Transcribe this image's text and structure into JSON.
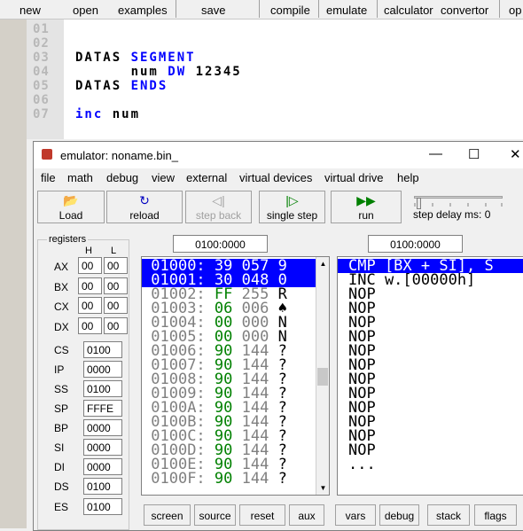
{
  "top_toolbar": {
    "items": [
      "new",
      "open",
      "examples",
      "save",
      "compile",
      "emulate",
      "calculator",
      "convertor",
      "op"
    ]
  },
  "editor": {
    "line_numbers": [
      "01",
      "02",
      "03",
      "04",
      "05",
      "06",
      "07"
    ],
    "lines": [
      {
        "kw": "",
        "text": ""
      },
      {
        "kw": "",
        "text": ""
      },
      {
        "pre": "DATAS ",
        "kw": "SEGMENT",
        "post": ""
      },
      {
        "pre": "      num ",
        "kw": "DW",
        "post": " 12345"
      },
      {
        "pre": "DATAS ",
        "kw": "ENDS",
        "post": ""
      },
      {
        "pre": "",
        "kw": "",
        "post": ""
      },
      {
        "pre": "",
        "kw": "inc",
        "post": " num"
      }
    ]
  },
  "emulator": {
    "title": "emulator: noname.bin_",
    "window_controls": {
      "minimize": "—",
      "maximize": "☐",
      "close": "✕"
    },
    "menu": [
      "file",
      "math",
      "debug",
      "view",
      "external",
      "virtual devices",
      "virtual drive",
      "help"
    ],
    "toolbar": [
      {
        "label": "Load",
        "icon": "📂",
        "icon_name": "folder-open-icon",
        "enabled": true
      },
      {
        "label": "reload",
        "icon": "↻",
        "icon_name": "reload-icon",
        "enabled": true
      },
      {
        "label": "step back",
        "icon": "◁|",
        "icon_name": "step-back-icon",
        "enabled": false
      },
      {
        "label": "single step",
        "icon": "|▷",
        "icon_name": "single-step-icon",
        "enabled": true
      },
      {
        "label": "run",
        "icon": "▶▶",
        "icon_name": "run-icon",
        "enabled": true
      }
    ],
    "step_delay_label": "step delay ms: 0",
    "step_delay_ms": 0,
    "registers": {
      "title": "registers",
      "col_h": "H",
      "col_l": "L",
      "general": [
        {
          "name": "AX",
          "h": "00",
          "l": "00"
        },
        {
          "name": "BX",
          "h": "00",
          "l": "00"
        },
        {
          "name": "CX",
          "h": "00",
          "l": "00"
        },
        {
          "name": "DX",
          "h": "00",
          "l": "00"
        }
      ],
      "segment": [
        {
          "name": "CS",
          "value": "0100"
        },
        {
          "name": "IP",
          "value": "0000"
        },
        {
          "name": "SS",
          "value": "0100"
        },
        {
          "name": "SP",
          "value": "FFFE"
        },
        {
          "name": "BP",
          "value": "0000"
        },
        {
          "name": "SI",
          "value": "0000"
        },
        {
          "name": "DI",
          "value": "0000"
        },
        {
          "name": "DS",
          "value": "0100"
        },
        {
          "name": "ES",
          "value": "0100"
        }
      ]
    },
    "memory_address": "0100:0000",
    "disasm_address": "0100:0000",
    "memory": [
      {
        "addr": "01000:",
        "hex": "39",
        "dec": "057",
        "ch": "9",
        "selected": true
      },
      {
        "addr": "01001:",
        "hex": "30",
        "dec": "048",
        "ch": "0",
        "selected": true
      },
      {
        "addr": "01002:",
        "hex": "FF",
        "dec": "255",
        "ch": "R",
        "selected": false
      },
      {
        "addr": "01003:",
        "hex": "06",
        "dec": "006",
        "ch": "♠",
        "selected": false
      },
      {
        "addr": "01004:",
        "hex": "00",
        "dec": "000",
        "ch": "N",
        "selected": false
      },
      {
        "addr": "01005:",
        "hex": "00",
        "dec": "000",
        "ch": "N",
        "selected": false
      },
      {
        "addr": "01006:",
        "hex": "90",
        "dec": "144",
        "ch": "?",
        "selected": false
      },
      {
        "addr": "01007:",
        "hex": "90",
        "dec": "144",
        "ch": "?",
        "selected": false
      },
      {
        "addr": "01008:",
        "hex": "90",
        "dec": "144",
        "ch": "?",
        "selected": false
      },
      {
        "addr": "01009:",
        "hex": "90",
        "dec": "144",
        "ch": "?",
        "selected": false
      },
      {
        "addr": "0100A:",
        "hex": "90",
        "dec": "144",
        "ch": "?",
        "selected": false
      },
      {
        "addr": "0100B:",
        "hex": "90",
        "dec": "144",
        "ch": "?",
        "selected": false
      },
      {
        "addr": "0100C:",
        "hex": "90",
        "dec": "144",
        "ch": "?",
        "selected": false
      },
      {
        "addr": "0100D:",
        "hex": "90",
        "dec": "144",
        "ch": "?",
        "selected": false
      },
      {
        "addr": "0100E:",
        "hex": "90",
        "dec": "144",
        "ch": "?",
        "selected": false
      },
      {
        "addr": "0100F:",
        "hex": "90",
        "dec": "144",
        "ch": "?",
        "selected": false
      }
    ],
    "disasm": [
      {
        "text": "CMP [BX + SI], S",
        "selected": true
      },
      {
        "text": "INC w.[00000h]",
        "selected": false
      },
      {
        "text": "NOP",
        "selected": false
      },
      {
        "text": "NOP",
        "selected": false
      },
      {
        "text": "NOP",
        "selected": false
      },
      {
        "text": "NOP",
        "selected": false
      },
      {
        "text": "NOP",
        "selected": false
      },
      {
        "text": "NOP",
        "selected": false
      },
      {
        "text": "NOP",
        "selected": false
      },
      {
        "text": "NOP",
        "selected": false
      },
      {
        "text": "NOP",
        "selected": false
      },
      {
        "text": "NOP",
        "selected": false
      },
      {
        "text": "NOP",
        "selected": false
      },
      {
        "text": "NOP",
        "selected": false
      },
      {
        "text": "...",
        "selected": false
      }
    ],
    "bottom_buttons": [
      "screen",
      "source",
      "reset",
      "aux",
      "vars",
      "debug",
      "stack",
      "flags"
    ]
  },
  "colors": {
    "selection": "#0000ff",
    "keyword": "#0000ff",
    "hex_green": "#008000",
    "gray": "#808080"
  }
}
